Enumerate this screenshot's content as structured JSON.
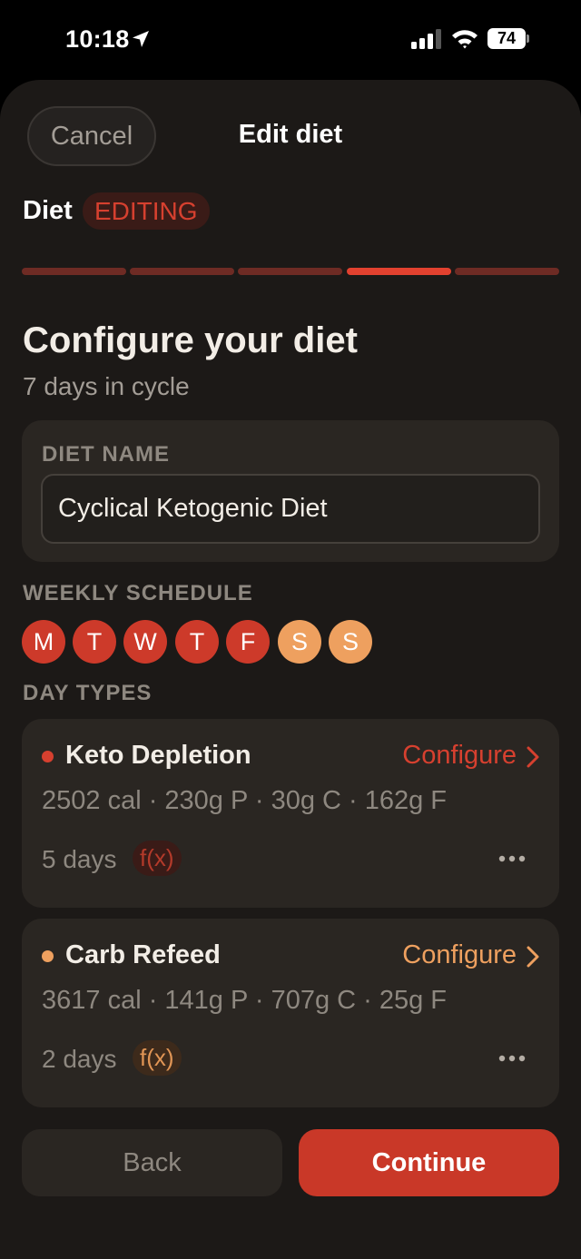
{
  "status_bar": {
    "time": "10:18",
    "battery": "74"
  },
  "header": {
    "cancel_label": "Cancel",
    "title": "Edit diet"
  },
  "breadcrumb": {
    "label": "Diet",
    "badge": "EDITING"
  },
  "progress": {
    "steps": 5,
    "current_step": 4
  },
  "main": {
    "title": "Configure your diet",
    "subtitle": "7 days in cycle",
    "diet_name_label": "DIET NAME",
    "diet_name_value": "Cyclical Ketogenic Diet",
    "weekly_schedule_label": "WEEKLY SCHEDULE",
    "days": [
      {
        "letter": "M",
        "type": "Keto Depletion"
      },
      {
        "letter": "T",
        "type": "Keto Depletion"
      },
      {
        "letter": "W",
        "type": "Keto Depletion"
      },
      {
        "letter": "T",
        "type": "Keto Depletion"
      },
      {
        "letter": "F",
        "type": "Keto Depletion"
      },
      {
        "letter": "S",
        "type": "Carb Refeed"
      },
      {
        "letter": "S",
        "type": "Carb Refeed"
      }
    ],
    "day_types_label": "DAY TYPES",
    "day_types": [
      {
        "name": "Keto Depletion",
        "configure_label": "Configure",
        "macros": "2502 cal · 230g P · 30g C · 162g F",
        "days_count": "5 days",
        "formula_badge": "f(x)",
        "color": "#d6402f"
      },
      {
        "name": "Carb Refeed",
        "configure_label": "Configure",
        "macros": "3617 cal · 141g P · 707g C · 25g F",
        "days_count": "2 days",
        "formula_badge": "f(x)",
        "color": "#eea05f"
      }
    ]
  },
  "footer": {
    "back_label": "Back",
    "continue_label": "Continue"
  },
  "colors": {
    "accent_red": "#c93828",
    "accent_orange": "#eea05f",
    "sheet_background": "#1c1917",
    "card_background": "#2a2622"
  }
}
